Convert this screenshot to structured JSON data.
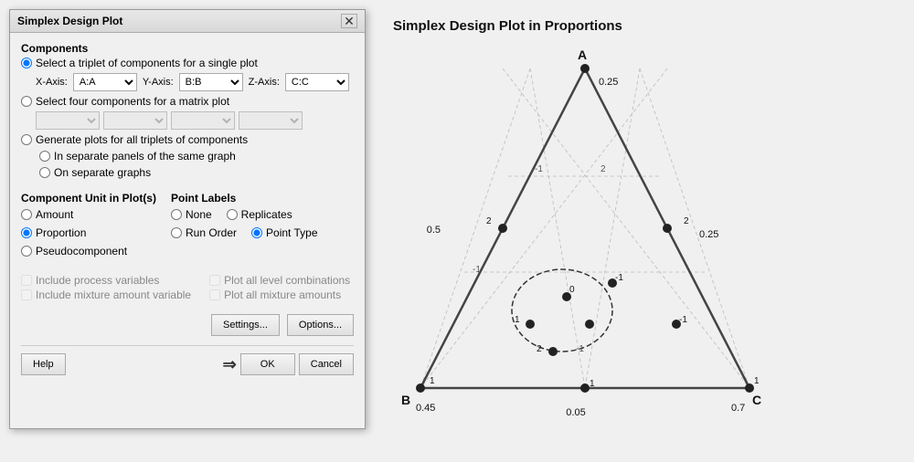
{
  "dialog": {
    "title": "Simplex Design Plot",
    "sections": {
      "components_label": "Components",
      "triplet_radio": "Select a triplet of components for a single plot",
      "xaxis_label": "X-Axis:",
      "xaxis_value": "A:A",
      "yaxis_label": "Y-Axis:",
      "yaxis_value": "B:B",
      "zaxis_label": "Z-Axis:",
      "zaxis_value": "C:C",
      "matrix_radio": "Select four components for a matrix plot",
      "all_triplets_radio": "Generate plots for all triplets of components",
      "separate_panels_radio": "In separate panels of the same graph",
      "separate_graphs_radio": "On separate graphs",
      "unit_label": "Component Unit in Plot(s)",
      "amount_radio": "Amount",
      "proportion_radio": "Proportion",
      "pseudocomponent_radio": "Pseudocomponent",
      "point_labels_label": "Point Labels",
      "none_radio": "None",
      "replicates_radio": "Replicates",
      "run_order_radio": "Run Order",
      "point_type_radio": "Point Type",
      "include_process_cb": "Include process variables",
      "include_mixture_cb": "Include mixture amount variable",
      "plot_level_cb": "Plot all level combinations",
      "plot_amounts_cb": "Plot all mixture amounts"
    },
    "buttons": {
      "settings": "Settings...",
      "options": "Options...",
      "help": "Help",
      "ok": "OK",
      "cancel": "Cancel"
    }
  },
  "chart": {
    "title": "Simplex Design Plot in Proportions",
    "vertex_a": "A",
    "vertex_b": "B",
    "vertex_c": "C",
    "label_a_val": "0.25",
    "label_b_val": "0.45",
    "label_c_val": "0.7",
    "label_mid_bc": "0.05",
    "label_left": "0.5",
    "label_right": "0.25"
  }
}
